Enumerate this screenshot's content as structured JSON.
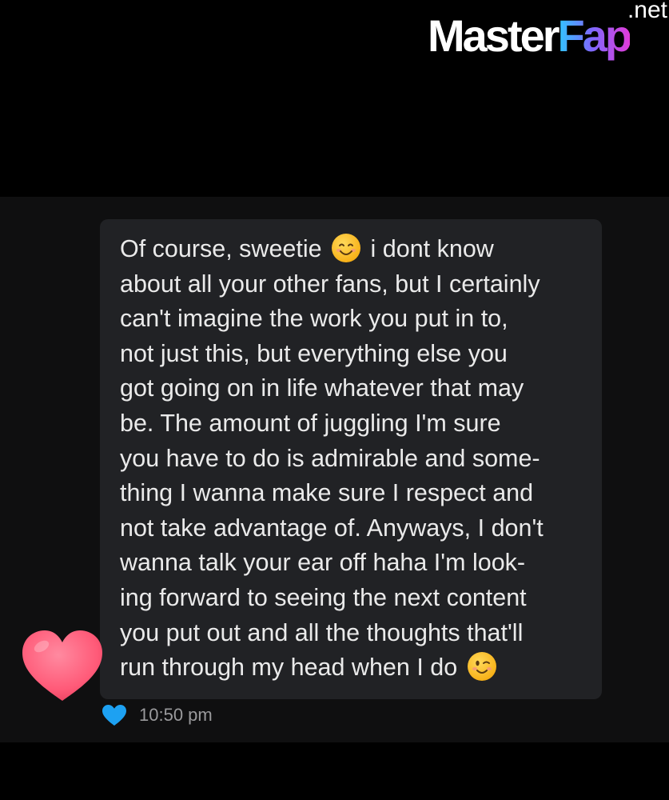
{
  "watermark": {
    "main": "Master",
    "accent": "Fap",
    "tld": ".net"
  },
  "message": {
    "lines": [
      [
        "Of course, sweetie ",
        "smiling-face-emoji",
        " i dont know"
      ],
      [
        "about all your other fans, but I certainly"
      ],
      [
        "can't imagine the work you put in to,"
      ],
      [
        "not just this, but everything else you"
      ],
      [
        "got going on in life whatever that may"
      ],
      [
        "be. The amount of juggling I'm sure"
      ],
      [
        "you have to do is admirable and some-"
      ],
      [
        "thing I wanna make sure I respect and"
      ],
      [
        "not take advantage of. Anyways, I don't"
      ],
      [
        "wanna talk your ear off haha I'm look-"
      ],
      [
        "ing forward to seeing the next content"
      ],
      [
        "you put out and all the thoughts that'll"
      ],
      [
        "run through my head when I do ",
        "winking-face-emoji"
      ]
    ],
    "line_1_before_emoji": "Of course, sweetie",
    "line_1_after_emoji": "i dont know",
    "line_2": "about all your other fans, but I certainly",
    "line_3": "can't imagine the work you put in to,",
    "line_4": "not just this, but everything else you",
    "line_5": "got going on in life whatever that may",
    "line_6": "be. The amount of juggling I'm sure",
    "line_7": "you have to do is admirable and some-",
    "line_8": "thing I wanna make sure I respect and",
    "line_9": "not take advantage of. Anyways, I don't",
    "line_10": "wanna talk your ear off haha I'm look-",
    "line_11": "ing forward to seeing the next content",
    "line_12": "you put out and all the thoughts that'll",
    "line_13_before_emoji": "run through my head when I do",
    "reaction_icon": "heart-reaction-icon",
    "reaction_color": "#ff5a78",
    "liked_icon": "blue-heart-icon",
    "liked_color": "#1da1f2",
    "timestamp": "10:50 pm"
  }
}
